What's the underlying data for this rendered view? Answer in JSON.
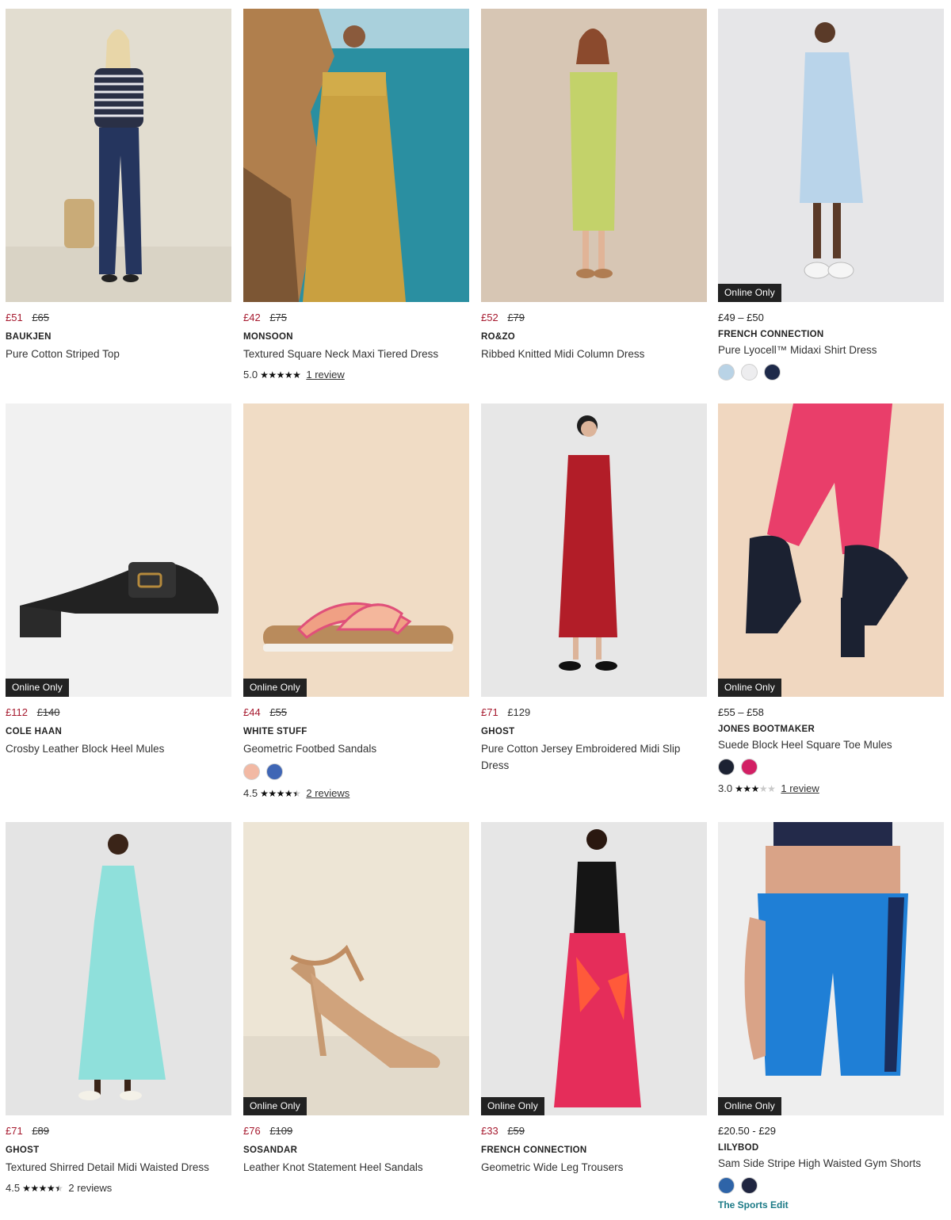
{
  "badge_label": "Online Only",
  "products": [
    {
      "brand": "BAUKJEN",
      "name": "Pure Cotton Striped Top",
      "price_now": "£51",
      "price_was": "£65"
    },
    {
      "brand": "MONSOON",
      "name": "Textured Square Neck Maxi Tiered Dress",
      "price_now": "£42",
      "price_was": "£75",
      "rating": "5.0",
      "stars": 5,
      "reviews": "1 review"
    },
    {
      "brand": "RO&ZO",
      "name": "Ribbed Knitted Midi Column Dress",
      "price_now": "£52",
      "price_was": "£79"
    },
    {
      "brand": "FRENCH CONNECTION",
      "name": "Pure Lyocell™ Midaxi Shirt Dress",
      "price_range": "£49 – £50",
      "swatches": [
        "#b9d3e6",
        "#ededef",
        "#1e2a4a"
      ]
    },
    {
      "brand": "COLE HAAN",
      "name": "Crosby Leather Block Heel Mules",
      "price_now": "£112",
      "price_was": "£140"
    },
    {
      "brand": "WHITE STUFF",
      "name": "Geometric Footbed Sandals",
      "price_now": "£44",
      "price_was": "£55",
      "swatches": [
        "#f2b9a4",
        "#3f66b5"
      ],
      "rating": "4.5",
      "stars": 4.5,
      "reviews": "2 reviews"
    },
    {
      "brand": "GHOST",
      "name": "Pure Cotton Jersey Embroidered Midi Slip Dress",
      "price_now": "£71",
      "price_was": "£129"
    },
    {
      "brand": "JONES BOOTMAKER",
      "name": "Suede Block Heel Square Toe Mules",
      "price_range": "£55 – £58",
      "swatches": [
        "#1c2233",
        "#d21f64"
      ],
      "rating": "3.0",
      "stars": 3,
      "reviews": "1 review"
    },
    {
      "brand": "GHOST",
      "name": "Textured Shirred Detail Midi Waisted Dress",
      "price_now": "£71",
      "price_was": "£89",
      "rating": "4.5",
      "stars": 4.5,
      "reviews": "2 reviews"
    },
    {
      "brand": "SOSANDAR",
      "name": "Leather Knot Statement Heel Sandals",
      "price_now": "£76",
      "price_was": "£109"
    },
    {
      "brand": "FRENCH CONNECTION",
      "name": "Geometric Wide Leg Trousers",
      "price_now": "£33",
      "price_was": "£59"
    },
    {
      "brand": "LILYBOD",
      "name": "Sam Side Stripe High Waisted Gym Shorts",
      "price_range": "£20.50 - £29",
      "swatches": [
        "#2e64a8",
        "#1f2540"
      ],
      "edit_link": "The Sports Edit"
    }
  ]
}
